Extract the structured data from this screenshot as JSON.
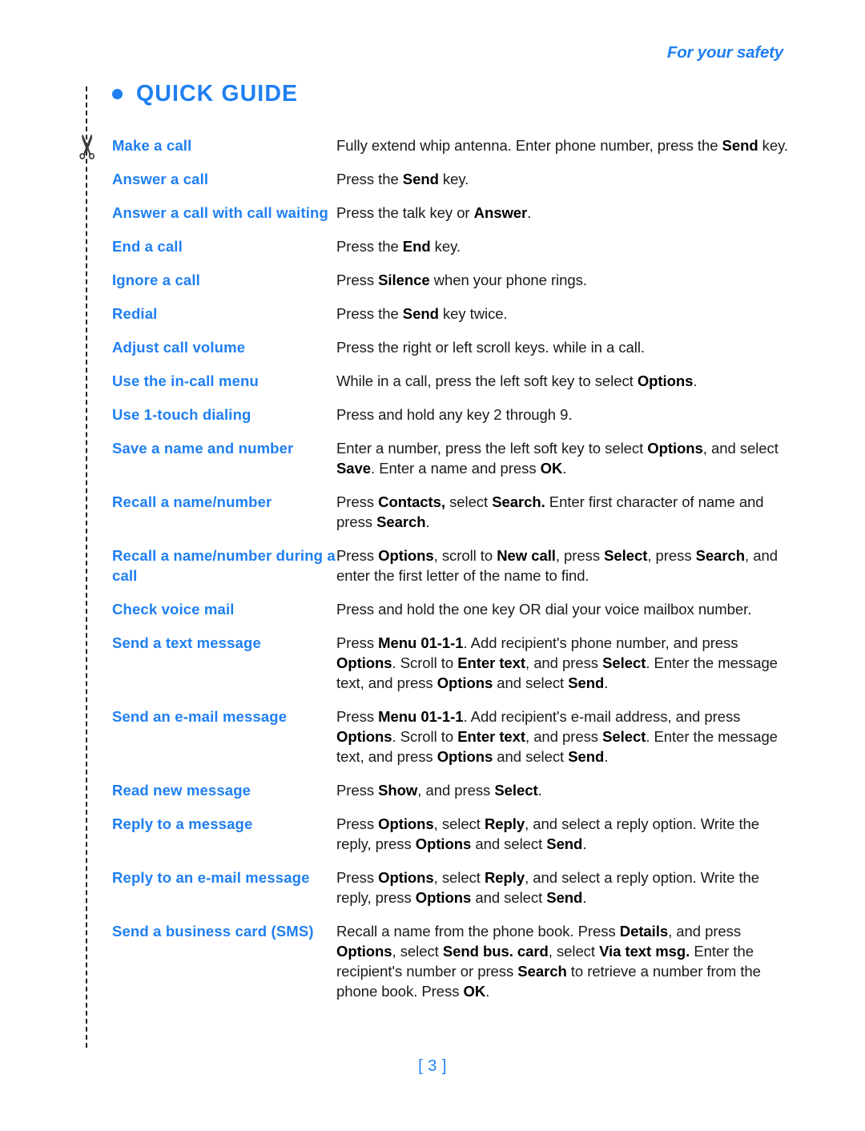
{
  "header": {
    "running_head": "For your safety"
  },
  "title": {
    "bullet_icon": "bullet-dot",
    "text": "QUICK GUIDE"
  },
  "cut_line": {
    "scissors_icon": "scissors-icon"
  },
  "footer": {
    "page_number": "[ 3 ]"
  },
  "colors": {
    "accent_blue": "#1f7ff2",
    "body_text": "#1a1a1a",
    "cut_line": "#231f20"
  },
  "guide": {
    "rows": [
      {
        "label": "Make a call",
        "desc_html": "Fully extend whip antenna. Enter phone number, press the <b>Send</b> key."
      },
      {
        "label": "Answer a call",
        "desc_html": "Press the <b>Send</b> key."
      },
      {
        "label": "Answer a call with call waiting",
        "desc_html": "Press the talk key or <b>Answer</b>."
      },
      {
        "label": "End a call",
        "desc_html": "Press the <b>End</b> key."
      },
      {
        "label": "Ignore a call",
        "desc_html": "Press <b>Silence</b> when your phone rings."
      },
      {
        "label": "Redial",
        "desc_html": "Press the <b>Send</b> key twice."
      },
      {
        "label": "Adjust call volume",
        "desc_html": "Press the right or left scroll keys. while in a call."
      },
      {
        "label": "Use the in-call menu",
        "desc_html": "While in a call, press the left soft key to select <b>Options</b>."
      },
      {
        "label": "Use 1-touch dialing",
        "desc_html": "Press and hold any key 2 through 9."
      },
      {
        "label": "Save a name and number",
        "desc_html": "Enter a number, press the left soft key to select <b>Options</b>, and select <b>Save</b>. Enter a name and press <b>OK</b>."
      },
      {
        "label": "Recall a name/number",
        "desc_html": "Press <b>Contacts,</b> select <b>Search.</b> Enter first character of name and press <b>Search</b>."
      },
      {
        "label": "Recall a name/number during a call",
        "desc_html": "Press <b>Options</b>, scroll to <b>New call</b>, press <b>Select</b>, press <b>Search</b>, and enter the first letter of the name to find."
      },
      {
        "label": "Check voice mail",
        "desc_html": "Press and hold the one key OR dial your voice mailbox number."
      },
      {
        "label": "Send a text message",
        "desc_html": "Press <b>Menu 01-1-1</b>. Add recipient's phone number, and press <b>Options</b>. Scroll to <b>Enter text</b>, and press <b>Select</b>. Enter the message text, and press <b>Options</b> and select <b>Send</b>."
      },
      {
        "label": "Send an e-mail message",
        "desc_html": "Press <b>Menu 01-1-1</b>. Add recipient's e-mail address, and press <b>Options</b>. Scroll to <b>Enter text</b>, and press <b>Select</b>. Enter the message text, and press <b>Options</b> and select <b>Send</b>."
      },
      {
        "label": "Read new message",
        "desc_html": "Press <b>Show</b>, and press <b>Select</b>."
      },
      {
        "label": "Reply to a message",
        "desc_html": "Press <b>Options</b>, select <b>Reply</b>, and select a reply option. Write the reply, press <b>Options</b> and select <b>Send</b>."
      },
      {
        "label": "Reply to an e-mail message",
        "desc_html": "Press <b>Options</b>, select <b>Reply</b>, and select a reply option. Write the reply, press <b>Options</b> and select <b>Send</b>."
      },
      {
        "label": "Send a business card (SMS)",
        "desc_html": "Recall a name from the phone book. Press <b>Details</b>, and press <b>Options</b>, select <b>Send bus. card</b>, select <b>Via text msg.</b> Enter the recipient's number or press <b>Search</b> to retrieve a number from the phone book. Press <b>OK</b>."
      }
    ]
  }
}
